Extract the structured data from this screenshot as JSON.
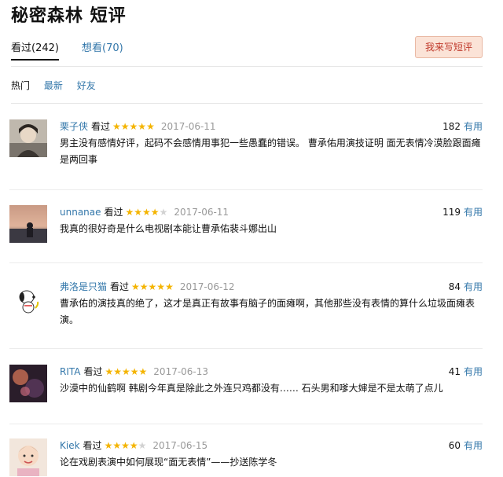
{
  "page": {
    "title": "秘密森林 短评"
  },
  "tabs": [
    {
      "label": "看过(242)"
    },
    {
      "label": "想看(70)"
    }
  ],
  "write_button": {
    "label": "我来写短评"
  },
  "sorts": [
    {
      "label": "热门"
    },
    {
      "label": "最新"
    },
    {
      "label": "好友"
    }
  ],
  "comments": [
    {
      "user": "栗子侠",
      "status": "看过",
      "rating": 5,
      "date": "2017-06-11",
      "votes": "182",
      "useful": "有用",
      "text": "男主没有感情好评，起码不会感情用事犯一些愚蠢的错误。 曹承佑用演技证明 面无表情冷漠脸跟面瘫是两回事"
    },
    {
      "user": "unnanae",
      "status": "看过",
      "rating": 4,
      "date": "2017-06-11",
      "votes": "119",
      "useful": "有用",
      "text": "我真的很好奇是什么电视剧本能让曹承佑裴斗娜出山"
    },
    {
      "user": "弗洛是只猫",
      "status": "看过",
      "rating": 5,
      "date": "2017-06-12",
      "votes": "84",
      "useful": "有用",
      "text": "曹承佑的演技真的绝了，这才是真正有故事有脑子的面瘫啊，其他那些没有表情的算什么垃圾面瘫表演。"
    },
    {
      "user": "RITA",
      "status": "看过",
      "rating": 5,
      "date": "2017-06-13",
      "votes": "41",
      "useful": "有用",
      "text": "沙漠中的仙鹤啊 韩剧今年真是除此之外连只鸡都没有…… 石头男和嗲大婶是不是太萌了点儿"
    },
    {
      "user": "Kiek",
      "status": "看过",
      "rating": 4,
      "date": "2017-06-15",
      "votes": "60",
      "useful": "有用",
      "text": "论在戏剧表演中如何展现“面无表情”——抄送陈学冬"
    }
  ]
}
